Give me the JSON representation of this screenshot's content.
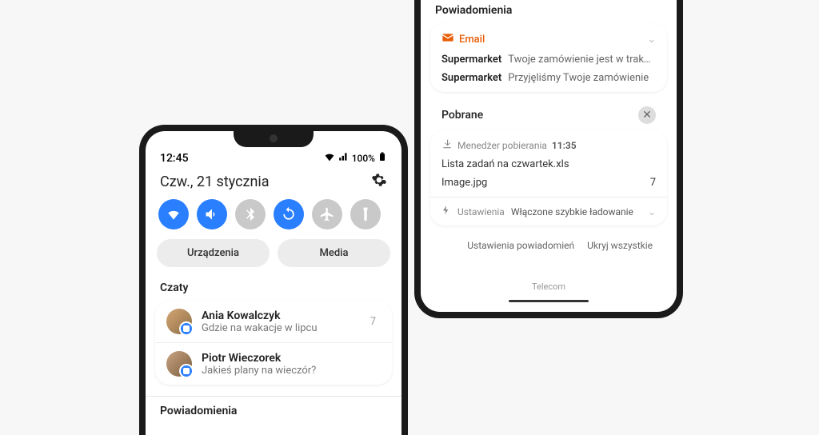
{
  "phone1": {
    "time": "12:45",
    "battery": "100%",
    "date": "Czw., 21 stycznia",
    "btn_devices": "Urządzenia",
    "btn_media": "Media",
    "section_chats": "Czaty",
    "chats": [
      {
        "name": "Ania Kowalczyk",
        "msg": "Gdzie na wakacje w lipcu",
        "count": "7"
      },
      {
        "name": "Piotr Wieczorek",
        "msg": "Jakieś plany na wieczór?",
        "count": ""
      }
    ],
    "section_notif": "Powiadomienia"
  },
  "phone2": {
    "section_notif": "Powiadomienia",
    "email_label": "Email",
    "email_rows": [
      {
        "from": "Supermarket",
        "text": "Twoje zamówienie jest w trakcie …"
      },
      {
        "from": "Supermarket",
        "text": "Przyjęliśmy Twoje zamówienie"
      }
    ],
    "downloads_title": "Pobrane",
    "dl_manager": "Menedżer pobierania",
    "dl_time": "11:35",
    "dl_items": [
      {
        "name": "Lista zadań na czwartek.xls",
        "count": ""
      },
      {
        "name": "Image.jpg",
        "count": "7"
      }
    ],
    "charging_app": "Ustawienia",
    "charging_text": "Włączone szybkie ładowanie",
    "link_settings": "Ustawienia powiadomień",
    "link_hide": "Ukryj wszystkie",
    "carrier": "Telecom"
  }
}
